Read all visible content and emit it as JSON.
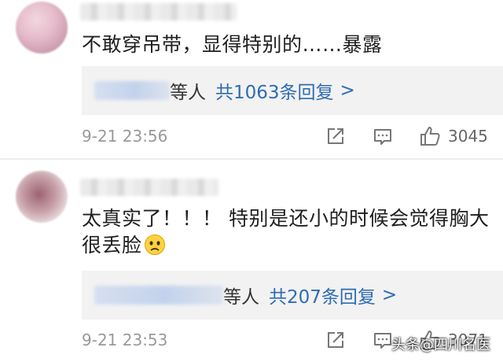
{
  "comments": [
    {
      "text": "不敢穿吊带，显得特别的……暴露",
      "reply_suffix": "等人",
      "reply_count": "共1063条回复",
      "reply_chevron": ">",
      "timestamp": "9-21 23:56",
      "like_count": "3045"
    },
    {
      "text": "太真实了！！！ 特别是还小的时候会觉得胸大很丢脸",
      "emoji": "sad-face-emoji",
      "reply_suffix": "等人",
      "reply_count": "共207条回复",
      "reply_chevron": ">",
      "timestamp": "9-21 23:53",
      "like_count": "3071"
    }
  ],
  "watermark": "头条@四川名医",
  "colors": {
    "link": "#2f6cb2",
    "reply_bg": "#f2f2f2",
    "meta": "#999999"
  },
  "icons": [
    "share-icon",
    "reply-icon",
    "like-icon"
  ]
}
